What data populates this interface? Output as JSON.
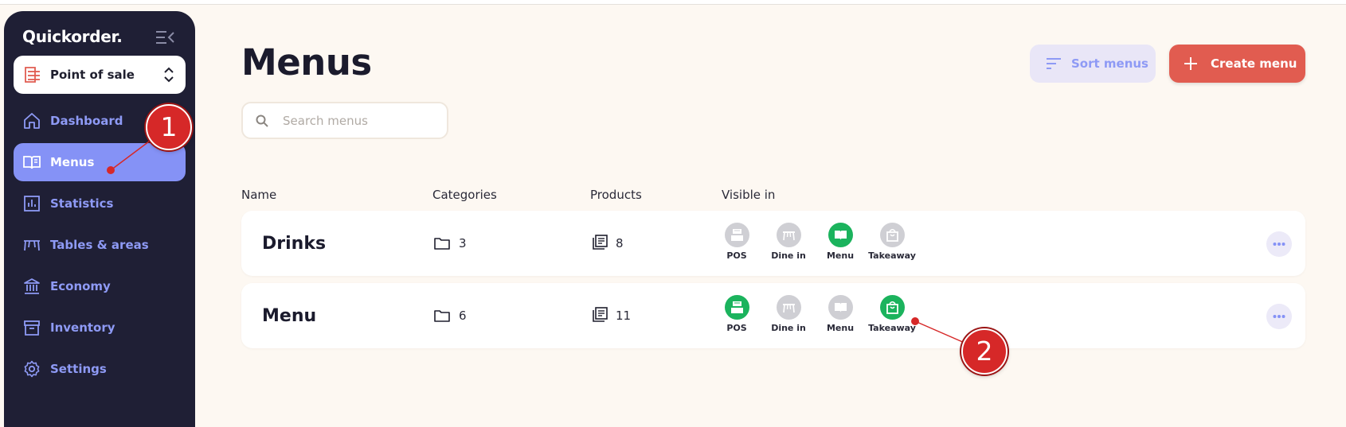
{
  "app": {
    "brand": "Quickorder."
  },
  "pos_selector": {
    "label": "Point of sale"
  },
  "sidebar": {
    "items": [
      {
        "label": "Dashboard",
        "icon": "home-icon",
        "active": false
      },
      {
        "label": "Menus",
        "icon": "book-icon",
        "active": true
      },
      {
        "label": "Statistics",
        "icon": "chart-icon",
        "active": false
      },
      {
        "label": "Tables & areas",
        "icon": "table-icon",
        "active": false
      },
      {
        "label": "Economy",
        "icon": "bank-icon",
        "active": false
      },
      {
        "label": "Inventory",
        "icon": "archive-icon",
        "active": false
      },
      {
        "label": "Settings",
        "icon": "gear-icon",
        "active": false
      }
    ]
  },
  "header": {
    "title": "Menus",
    "sort_label": "Sort menus",
    "create_label": "Create menu"
  },
  "search": {
    "placeholder": "Search menus",
    "value": ""
  },
  "table": {
    "columns": [
      "Name",
      "Categories",
      "Products",
      "Visible in"
    ],
    "visibility_labels": [
      "POS",
      "Dine in",
      "Menu",
      "Takeaway"
    ],
    "rows": [
      {
        "name": "Drinks",
        "categories": "3",
        "products": "8",
        "visible": [
          false,
          false,
          true,
          false
        ]
      },
      {
        "name": "Menu",
        "categories": "6",
        "products": "11",
        "visible": [
          true,
          false,
          false,
          true
        ]
      }
    ]
  },
  "annotations": [
    "1",
    "2"
  ],
  "colors": {
    "accent": "#8592f6",
    "accent_text": "#8e9af5",
    "primary": "#e15c50",
    "sidebar_bg": "#1f1f35",
    "page_bg": "#fdf8f2",
    "visible_on": "#1bb35d",
    "visible_off": "#cfcfd4",
    "marker": "#d62828"
  }
}
